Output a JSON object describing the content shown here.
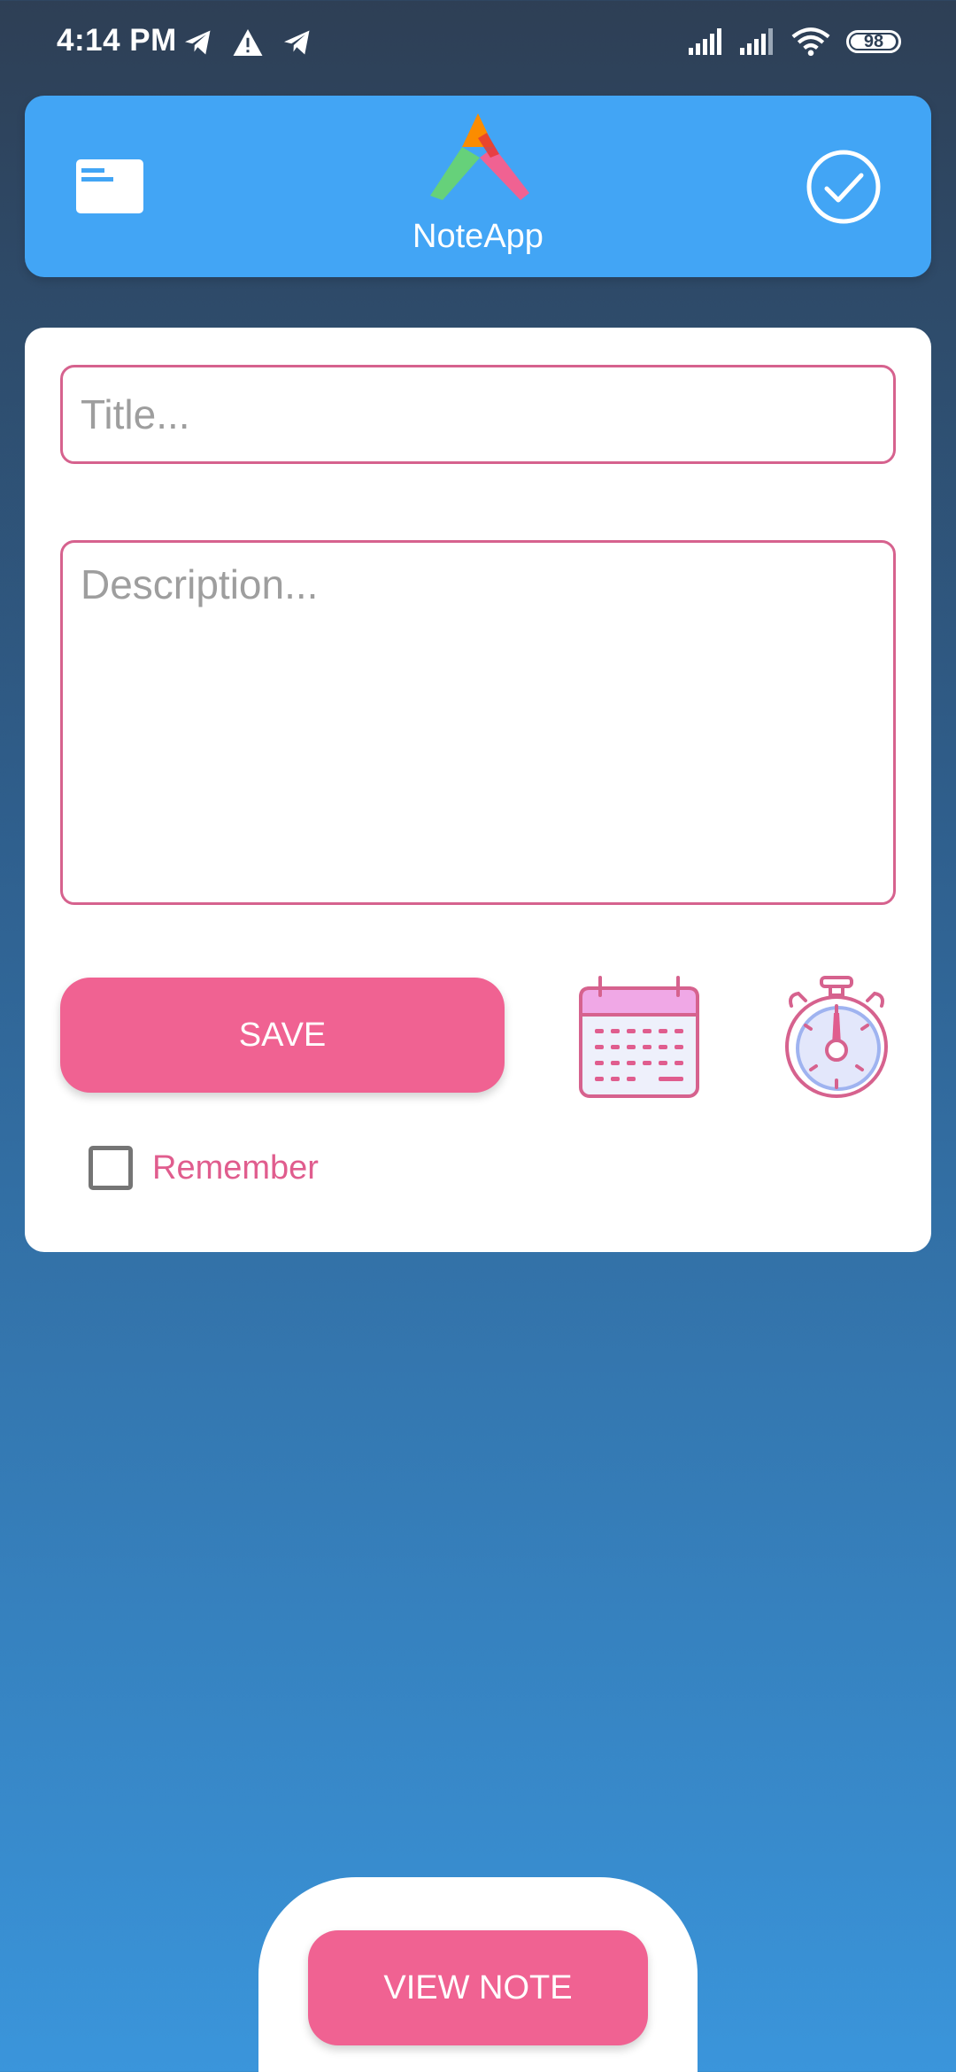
{
  "status_bar": {
    "time": "4:14 PM",
    "battery": "98",
    "battery_level_percent": 98,
    "left_icons": [
      "telegram-icon",
      "warning-icon",
      "telegram-icon"
    ],
    "right_icons": [
      "signal-icon",
      "signal-icon",
      "wifi-icon",
      "battery-icon"
    ]
  },
  "header": {
    "app_name": "NoteApp",
    "background_color": "#42a5f5",
    "menu_icon": "card-icon",
    "logo_icon": "app-logo-icon",
    "confirm_icon": "check-circle-icon"
  },
  "form": {
    "title_placeholder": "Title...",
    "title_value": "",
    "description_placeholder": "Description...",
    "description_value": "",
    "save_label": "SAVE",
    "calendar_icon": "calendar-icon",
    "timer_icon": "stopwatch-icon",
    "remember_label": "Remember",
    "remember_checked": false,
    "accent_color": "#f06292",
    "border_color": "#d6628e"
  },
  "footer": {
    "view_note_label": "VIEW NOTE"
  }
}
